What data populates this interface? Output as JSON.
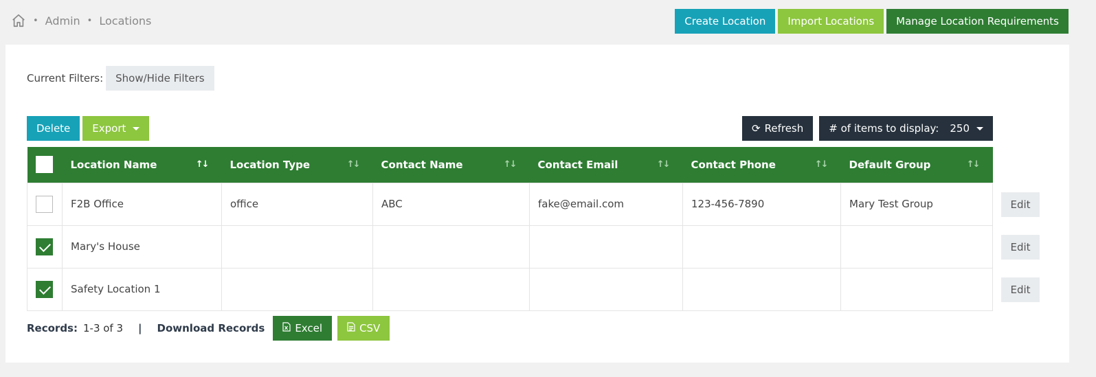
{
  "breadcrumb": {
    "home_icon": "home-icon",
    "items": [
      "Admin",
      "Locations"
    ]
  },
  "top_actions": {
    "create_label": "Create Location",
    "import_label": "Import Locations",
    "manage_label": "Manage Location Requirements"
  },
  "filters": {
    "label": "Current Filters:",
    "toggle_label": "Show/Hide Filters"
  },
  "list_actions": {
    "delete_label": "Delete",
    "export_label": "Export"
  },
  "display": {
    "refresh_label": "Refresh",
    "items_label": "# of items to display:",
    "items_value": "250"
  },
  "table": {
    "columns": [
      "Location Name",
      "Location Type",
      "Contact Name",
      "Contact Email",
      "Contact Phone",
      "Default Group"
    ],
    "rows": [
      {
        "checked": false,
        "cells": [
          "F2B Office",
          "office",
          "ABC",
          "fake@email.com",
          "123-456-7890",
          "Mary Test Group"
        ]
      },
      {
        "checked": true,
        "cells": [
          "Mary's House",
          "",
          "",
          "",
          "",
          ""
        ]
      },
      {
        "checked": true,
        "cells": [
          "Safety Location 1",
          "",
          "",
          "",
          "",
          ""
        ]
      }
    ],
    "edit_label": "Edit"
  },
  "footer": {
    "records_label": "Records:",
    "records_value": "1-3 of 3",
    "separator": "|",
    "download_label": "Download Records",
    "excel_label": "Excel",
    "csv_label": "CSV"
  },
  "colors": {
    "teal": "#17a2b8",
    "lime": "#8dc63f",
    "green": "#2e7d32",
    "dark": "#26313d",
    "arrow": "#17a2b8"
  }
}
